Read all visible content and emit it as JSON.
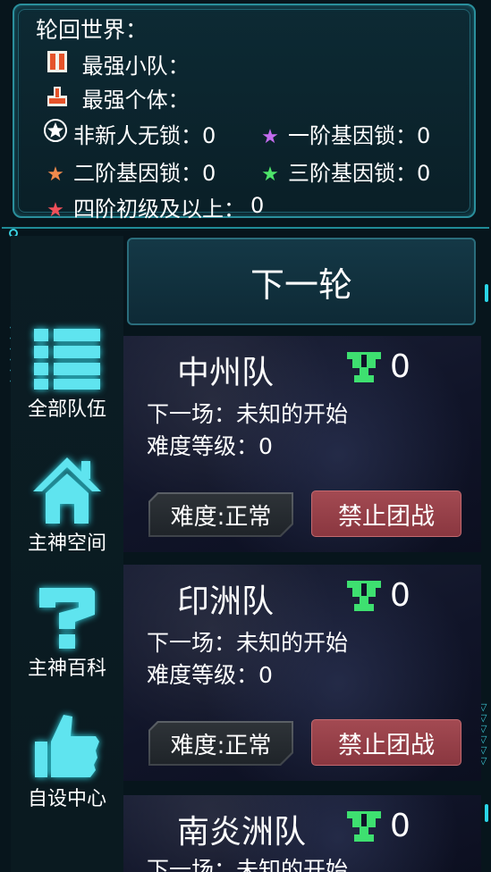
{
  "info": {
    "title": "轮回世界：",
    "strongest_team_label": "最强小队：",
    "strongest_individual_label": "最强个体：",
    "locks": [
      {
        "label": "非新人无锁：0",
        "icon": "circle-star-icon",
        "color": "#ffffff"
      },
      {
        "label": "一阶基因锁：0",
        "icon": "purple-star-icon",
        "color": "#c46cf0"
      },
      {
        "label": "二阶基因锁：0",
        "icon": "orange-star-icon",
        "color": "#f08a4c"
      },
      {
        "label": "三阶基因锁：0",
        "icon": "green-star-icon",
        "color": "#4ee46a"
      },
      {
        "label": "四阶初级及以上：",
        "icon": "red-star-icon",
        "color": "#f0505a"
      }
    ],
    "tier4_value": "0"
  },
  "next_round_label": "下一轮",
  "sidebar": {
    "items": [
      {
        "label": "全部队伍",
        "icon": "list-icon"
      },
      {
        "label": "主神空间",
        "icon": "home-icon"
      },
      {
        "label": "主神百科",
        "icon": "question-icon"
      },
      {
        "label": "自设中心",
        "icon": "thumbs-up-icon"
      }
    ]
  },
  "teams": [
    {
      "name": "中州队",
      "score": "0",
      "next_match": "下一场：未知的开始",
      "difficulty_level": "难度等级：0",
      "difficulty_button": "难度:正常",
      "ban_button": "禁止团战"
    },
    {
      "name": "印洲队",
      "score": "0",
      "next_match": "下一场：未知的开始",
      "difficulty_level": "难度等级：0",
      "difficulty_button": "难度:正常",
      "ban_button": "禁止团战"
    },
    {
      "name": "南炎洲队",
      "score": "0",
      "next_match": "下一场：未知的开始"
    }
  ],
  "colors": {
    "accent": "#2ad6e8",
    "ban_button": "#9a414a",
    "trophy": "#3ee070"
  }
}
